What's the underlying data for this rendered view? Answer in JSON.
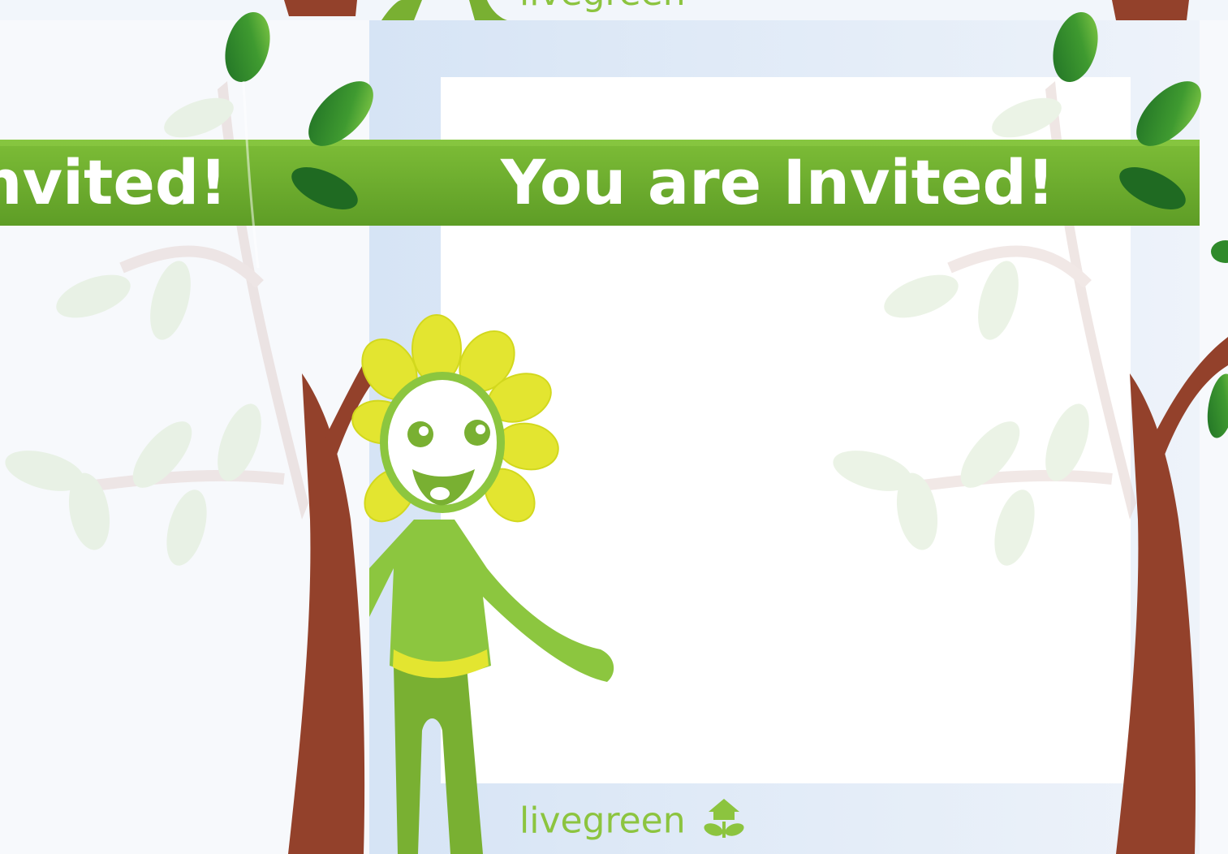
{
  "invitation": {
    "title": "You are Invited!",
    "title_left_fragment": "nvited!",
    "brand": "livegreen",
    "brand_top": "livegreen"
  },
  "icons": {
    "brand_logo": "house-plant-icon",
    "mascot": "sunflower-mascot",
    "tree": "tree-illustration"
  },
  "colors": {
    "banner": "#6fb02e",
    "trunk": "#93412b",
    "brand_text": "#8cc43f",
    "mascot_body": "#8cc63f",
    "petals": "#e3e530",
    "leaf_dark": "#2f8a2b"
  }
}
